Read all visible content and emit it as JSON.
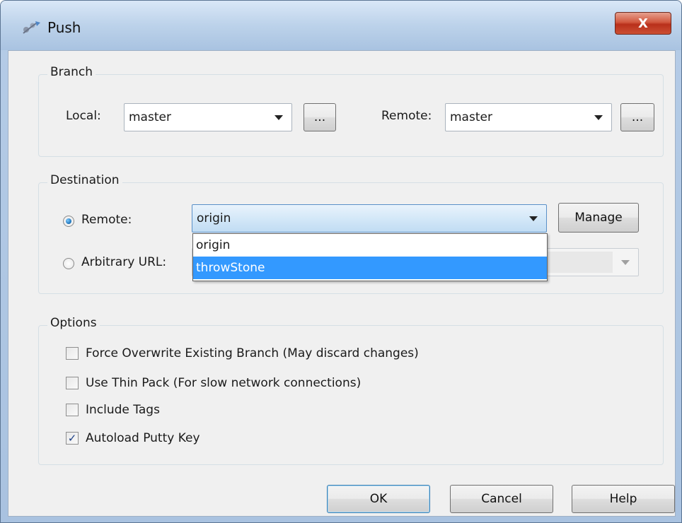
{
  "window": {
    "title": "Push",
    "close_label": "X"
  },
  "branch": {
    "group_label": "Branch",
    "local_label": "Local:",
    "local_value": "master",
    "local_browse_label": "...",
    "remote_label": "Remote:",
    "remote_value": "master",
    "remote_browse_label": "..."
  },
  "destination": {
    "group_label": "Destination",
    "remote_radio_label": "Remote:",
    "remote_selected": "origin",
    "manage_label": "Manage",
    "arbitrary_url_label": "Arbitrary URL:",
    "dropdown_options": [
      "origin",
      "throwStone"
    ],
    "highlighted_option": "throwStone"
  },
  "options": {
    "group_label": "Options",
    "items": [
      {
        "label": "Force Overwrite Existing Branch (May discard changes)",
        "checked": false
      },
      {
        "label": "Use Thin Pack (For slow network connections)",
        "checked": false
      },
      {
        "label": "Include Tags",
        "checked": false
      },
      {
        "label": "Autoload Putty Key",
        "checked": true
      }
    ]
  },
  "buttons": {
    "ok_label": "OK",
    "cancel_label": "Cancel",
    "help_label": "Help"
  },
  "colors": {
    "selection": "#3399ff",
    "title_bar": "#bcd2ea",
    "close_button": "#c8472d"
  }
}
